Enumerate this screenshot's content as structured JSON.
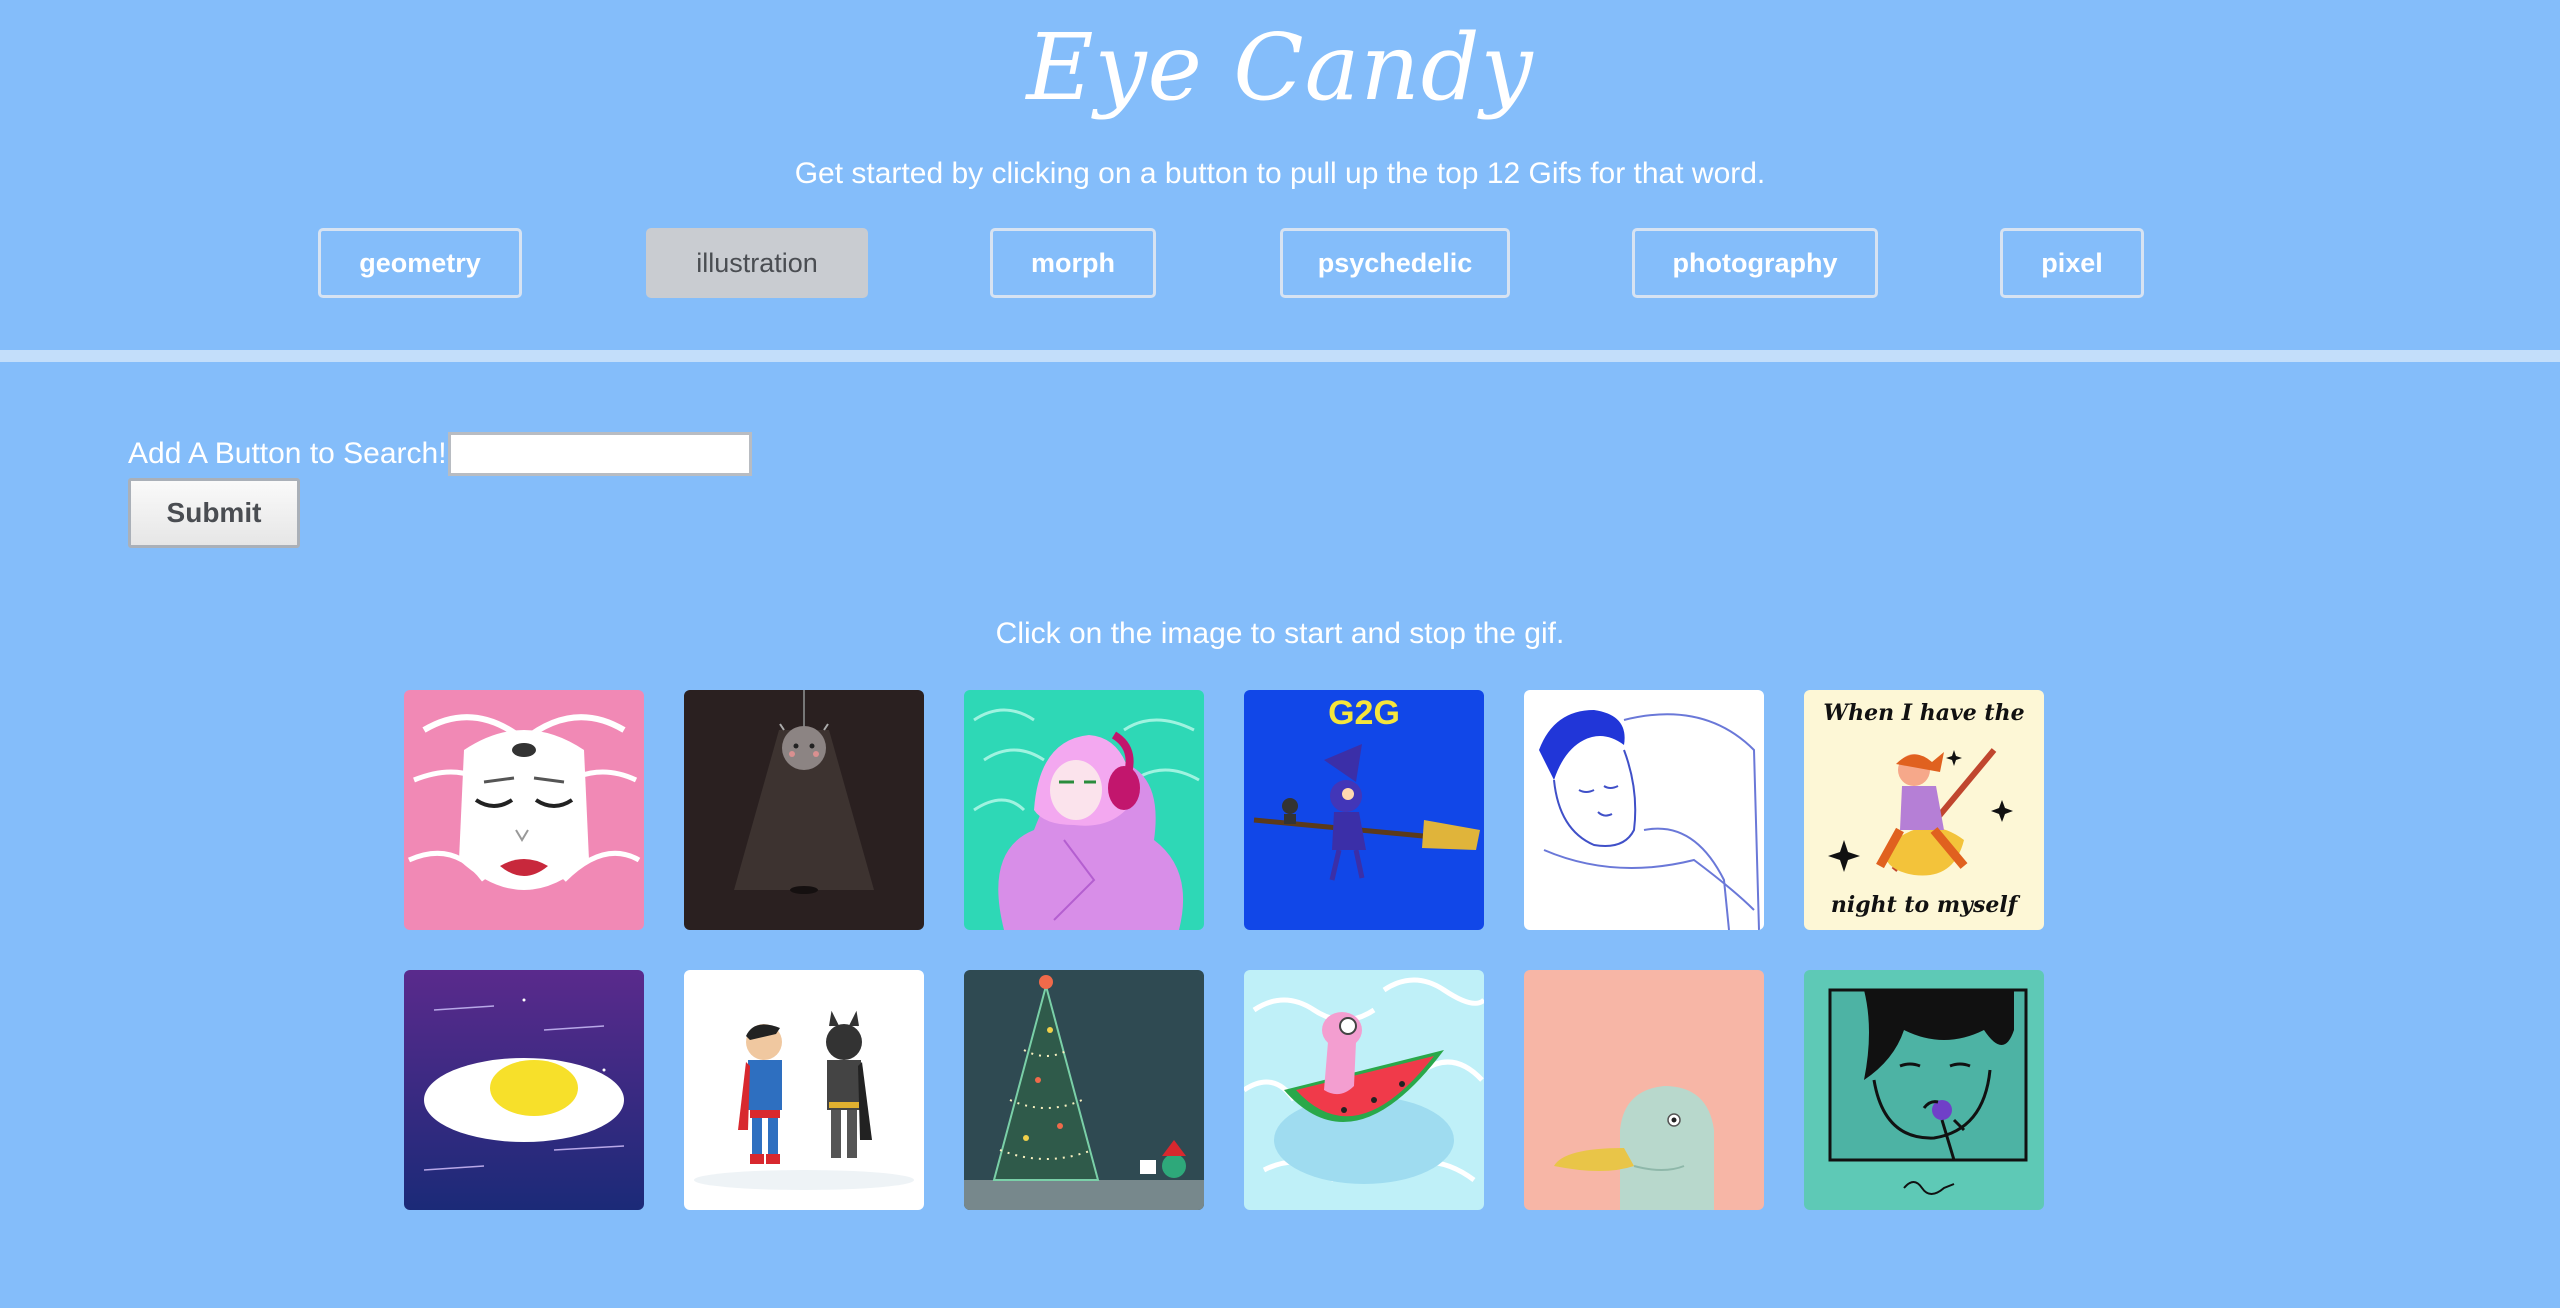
{
  "header": {
    "title": "Eye Candy",
    "subtitle": "Get started by clicking on a button to pull up the top 12 Gifs for that word."
  },
  "topics": [
    {
      "label": "geometry",
      "active": false
    },
    {
      "label": "illustration",
      "active": true
    },
    {
      "label": "morph",
      "active": false
    },
    {
      "label": "psychedelic",
      "active": false
    },
    {
      "label": "photography",
      "active": false
    },
    {
      "label": "pixel",
      "active": false
    }
  ],
  "add_form": {
    "label": "Add A Button to Search!",
    "input_value": "",
    "submit_label": "Submit"
  },
  "gallery": {
    "instruction": "Click on the image to start and stop the gif.",
    "images": [
      {
        "subject": "pink-hair-three-eyed-face-illustration"
      },
      {
        "subject": "hanging-lamp-creature-dark-room-illustration"
      },
      {
        "subject": "girl-with-headphones-purple-fur-illustration"
      },
      {
        "subject": "witch-on-broom-g2g-illustration",
        "text": "G2G"
      },
      {
        "subject": "sleeping-man-line-drawing-illustration"
      },
      {
        "subject": "girl-on-broom-night-illustration",
        "text_top": "When I have the",
        "text_bottom": "night to myself"
      },
      {
        "subject": "fried-egg-in-space-illustration"
      },
      {
        "subject": "superman-and-batman-illustration"
      },
      {
        "subject": "christmas-tree-lights-illustration"
      },
      {
        "subject": "creature-on-watermelon-float-illustration"
      },
      {
        "subject": "duck-on-peach-background-illustration"
      },
      {
        "subject": "face-with-lollipop-illustration"
      }
    ]
  },
  "colors": {
    "background": "#84bdfa",
    "active_button": "#c9ccd1",
    "divider": "#c3defa"
  }
}
